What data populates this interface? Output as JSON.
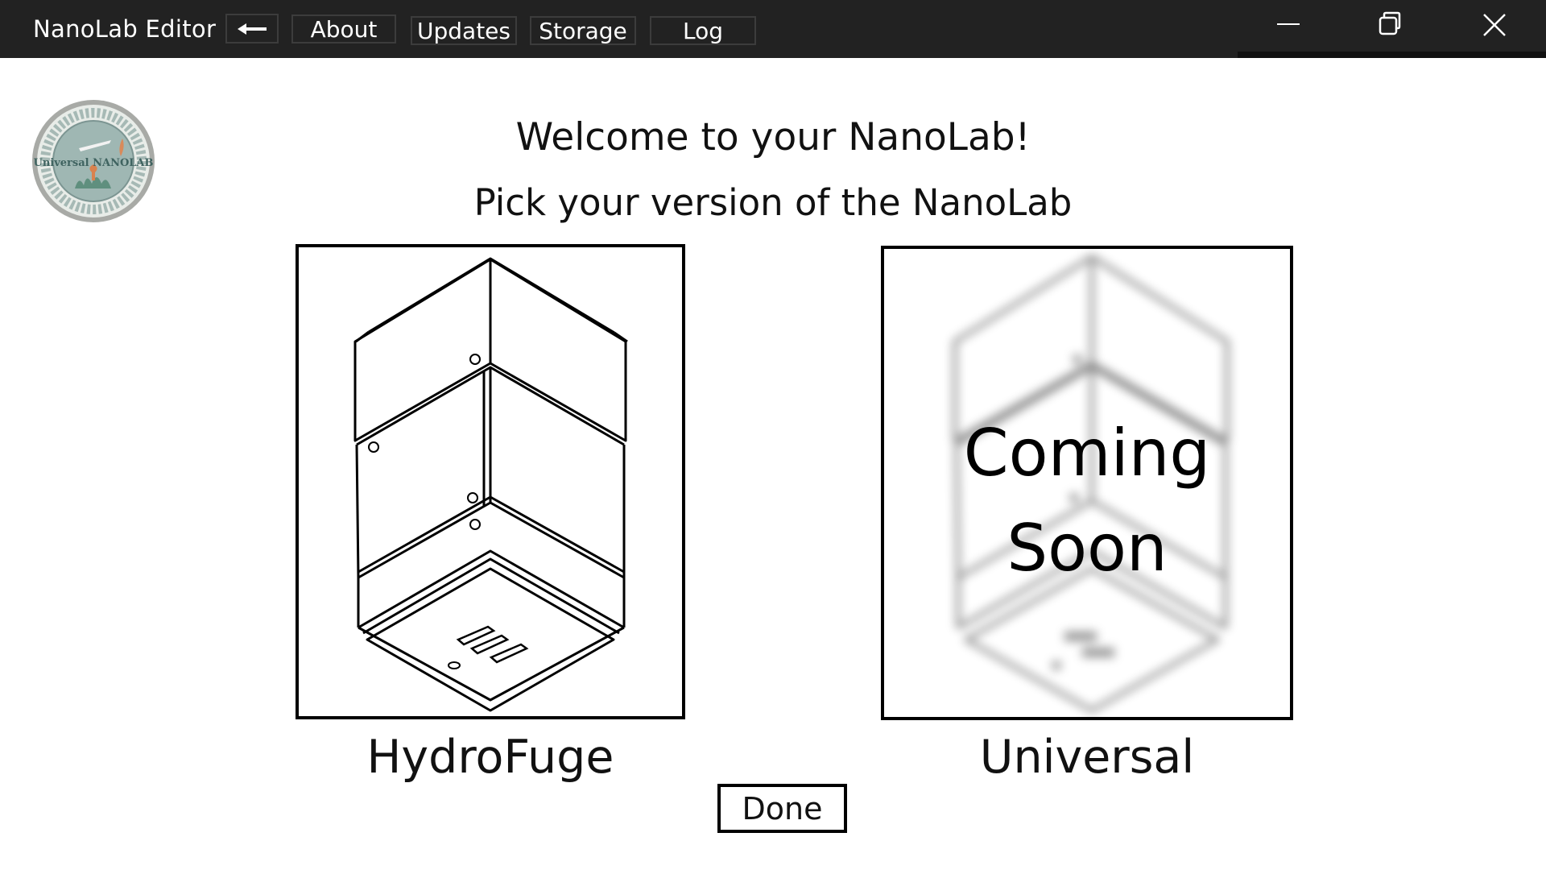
{
  "titlebar": {
    "app_title": "NanoLab Editor",
    "nav": {
      "back_icon": "arrow-left-icon",
      "about": "About",
      "updates": "Updates",
      "storage": "Storage",
      "log": "Log"
    },
    "window_controls": [
      "minimize-icon",
      "restore-icon",
      "close-icon"
    ],
    "colors": {
      "background": "#222222",
      "text": "#ffffff"
    }
  },
  "logo": {
    "icon": "universal-nanolab-seal",
    "text": "Universal NANOLAB"
  },
  "main": {
    "welcome": "Welcome to your NanoLab!",
    "subtitle": "Pick your version of the NanoLab",
    "options": [
      {
        "label": "HydroFuge",
        "image": "hydrofuge-device-drawing",
        "available": true
      },
      {
        "label": "Universal",
        "image": "universal-device-drawing-blurred",
        "available": false,
        "overlay_line1": "Coming",
        "overlay_line2": "Soon"
      }
    ],
    "done_label": "Done"
  }
}
